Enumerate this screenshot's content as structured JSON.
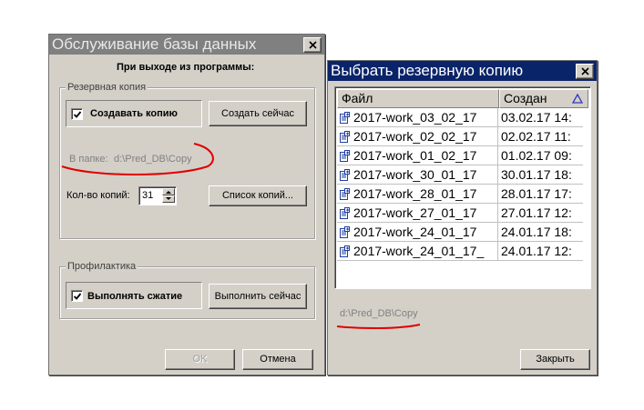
{
  "colors": {
    "title_active": "#0a246a",
    "title_inactive": "#808080",
    "annotation": "#e00000"
  },
  "maint": {
    "title": "Обслуживание базы данных",
    "on_exit_label": "При выходе из программы:",
    "backup_group": "Резервная копия",
    "create_backup_label": "Создавать копию",
    "create_backup_checked": true,
    "create_now_button": "Создать сейчас",
    "folder_label": "В папке:",
    "folder_path": "d:\\Pred_DB\\Copy",
    "copies_count_label": "Кол-во копий:",
    "copies_count_value": "31",
    "copies_list_button": "Список копий...",
    "maintenance_group": "Профилактика",
    "compress_label": "Выполнять сжатие",
    "compress_checked": true,
    "run_now_button": "Выполнить сейчас",
    "ok_button": "OK",
    "cancel_button": "Отмена"
  },
  "picker": {
    "title": "Выбрать резервную копию",
    "columns": {
      "file": "Файл",
      "created": "Создан"
    },
    "sort_icon": "sort-ascending-triangle-icon",
    "rows": [
      {
        "name": "2017-work_03_02_17",
        "created": "03.02.17  14:"
      },
      {
        "name": "2017-work_02_02_17",
        "created": "02.02.17  11:"
      },
      {
        "name": "2017-work_01_02_17",
        "created": "01.02.17  09:"
      },
      {
        "name": "2017-work_30_01_17",
        "created": "30.01.17  18:"
      },
      {
        "name": "2017-work_28_01_17",
        "created": "28.01.17  17:"
      },
      {
        "name": "2017-work_27_01_17",
        "created": "27.01.17  12:"
      },
      {
        "name": "2017-work_24_01_17",
        "created": "24.01.17  18:"
      },
      {
        "name": "2017-work_24_01_17_",
        "created": "24.01.17  12:"
      }
    ],
    "folder_path": "d:\\Pred_DB\\Copy",
    "close_button": "Закрыть"
  }
}
